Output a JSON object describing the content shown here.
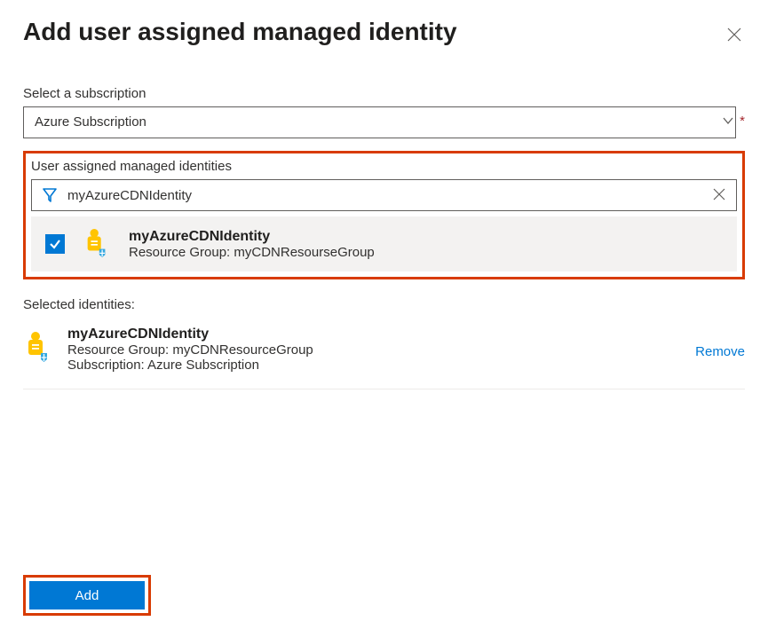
{
  "header": {
    "title": "Add user assigned managed identity"
  },
  "subscription": {
    "label": "Select a subscription",
    "value": "Azure Subscription"
  },
  "identities": {
    "section_label": "User assigned managed identities",
    "filter_value": "myAzureCDNIdentity",
    "items": [
      {
        "name": "myAzureCDNIdentity",
        "resource_group_line": "Resource Group: myCDNResourseGroup",
        "checked": true
      }
    ]
  },
  "selected": {
    "label": "Selected identities:",
    "items": [
      {
        "name": "myAzureCDNIdentity",
        "resource_group_line": "Resource Group: myCDNResourceGroup",
        "subscription_line": "Subscription: Azure Subscription"
      }
    ],
    "remove_label": "Remove"
  },
  "footer": {
    "add_label": "Add"
  }
}
